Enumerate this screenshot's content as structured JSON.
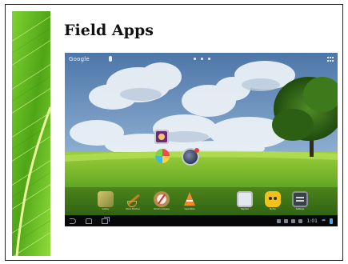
{
  "slide": {
    "title": "Field Apps"
  },
  "tablet_screen": {
    "status_bar": {
      "search_label": "Google",
      "icons": [
        "mic-icon",
        "apps-grid-icon"
      ]
    },
    "home_icons": [
      "purple-app-icon",
      "pinwheel-app-icon",
      "globe-app-icon"
    ],
    "dock": [
      {
        "label": "Gallery",
        "icon": "gallery-icon"
      },
      {
        "label": "Stock Practice",
        "icon": "stock-icon"
      },
      {
        "label": "Smart Compass",
        "icon": "compass-icon"
      },
      {
        "label": "SuperNote",
        "icon": "supernote-icon"
      },
      {
        "label": "Capture",
        "icon": "capture-icon"
      },
      {
        "label": "MyToy",
        "icon": "mytoy-icon"
      },
      {
        "label": "Settings",
        "icon": "settings-icon"
      }
    ],
    "nav_bar": {
      "clock": "1:01"
    }
  },
  "colors": {
    "leaf_green": "#5fb41c",
    "nav_black": "#060708",
    "wifi_blue": "#2f9be0"
  }
}
